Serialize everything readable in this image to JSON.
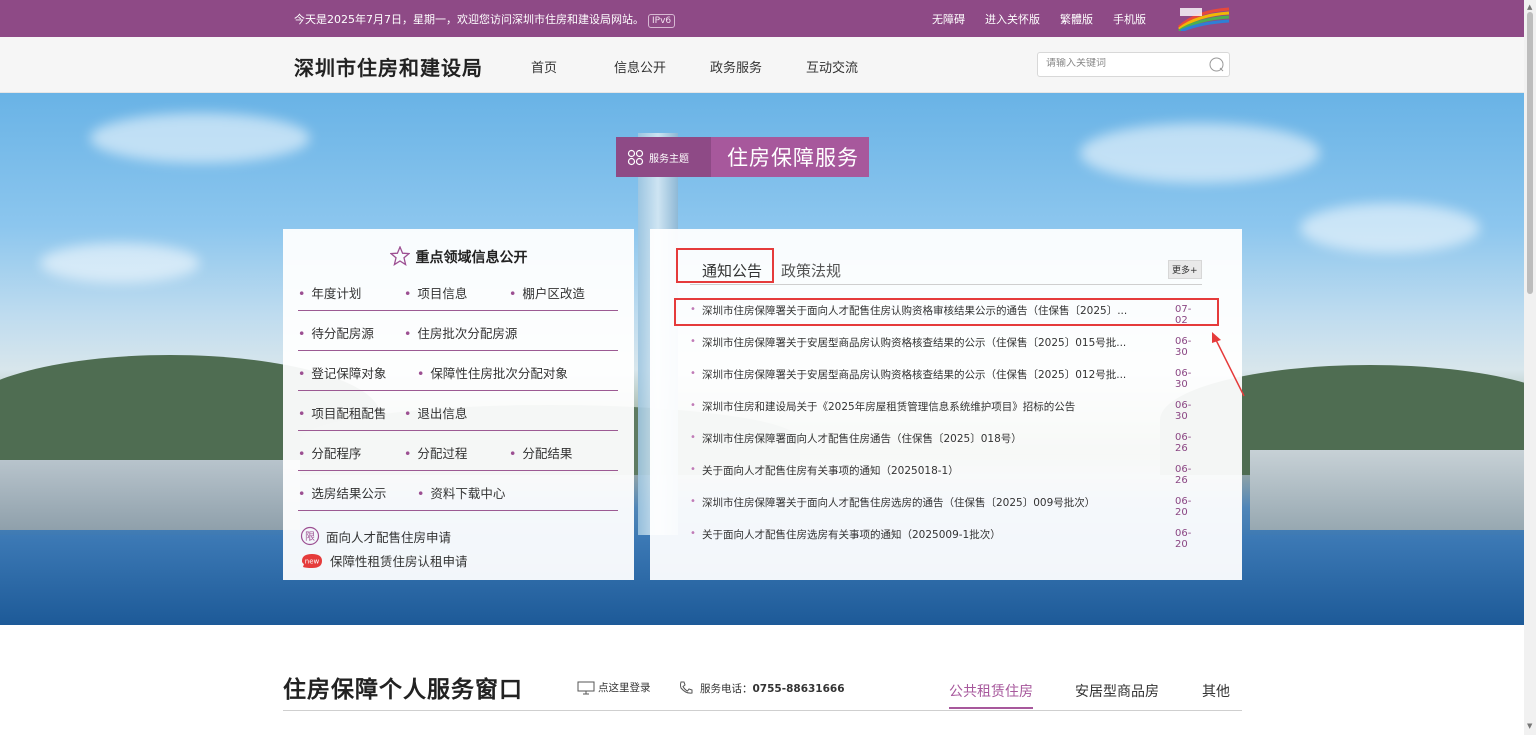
{
  "topbar": {
    "welcome": "今天是2025年7月7日，星期一，欢迎您访问深圳市住房和建设局网站。",
    "ipv6": "IPv6",
    "links": [
      "无障碍",
      "进入关怀版",
      "繁體版",
      "手机版"
    ]
  },
  "header": {
    "site_title": "深圳市住房和建设局",
    "nav": [
      "首页",
      "信息公开",
      "政务服务",
      "互动交流"
    ],
    "search_placeholder": "请输入关键词"
  },
  "theme": {
    "tag_label": "服务主题",
    "title": "住房保障服务"
  },
  "left_panel": {
    "title": "重点领域信息公开",
    "rows": [
      [
        "年度计划",
        "项目信息",
        "棚户区改造"
      ],
      [
        "待分配房源",
        "住房批次分配房源"
      ],
      [
        "登记保障对象",
        "保障性住房批次分配对象"
      ],
      [
        "项目配租配售",
        "退出信息"
      ],
      [
        "分配程序",
        "分配过程",
        "分配结果"
      ],
      [
        "选房结果公示",
        "资料下载中心"
      ]
    ],
    "apply_1": "面向人才配售住房申请",
    "apply_2": "保障性租赁住房认租申请",
    "new_badge": "new",
    "limit_badge": "限"
  },
  "right_panel": {
    "tabs": [
      "通知公告",
      "政策法规"
    ],
    "more": "更多+",
    "notices": [
      {
        "title": "深圳市住房保障署关于面向人才配售住房认购资格审核结果公示的通告（住保售〔2025〕...",
        "date": "07-02"
      },
      {
        "title": "深圳市住房保障署关于安居型商品房认购资格核查结果的公示（住保售〔2025〕015号批...",
        "date": "06-30"
      },
      {
        "title": "深圳市住房保障署关于安居型商品房认购资格核查结果的公示（住保售〔2025〕012号批...",
        "date": "06-30"
      },
      {
        "title": "深圳市住房和建设局关于《2025年房屋租赁管理信息系统维护项目》招标的公告",
        "date": "06-30"
      },
      {
        "title": "深圳市住房保障署面向人才配售住房通告（住保售〔2025〕018号）",
        "date": "06-26"
      },
      {
        "title": "关于面向人才配售住房有关事项的通知（2025018-1）",
        "date": "06-26"
      },
      {
        "title": "深圳市住房保障署关于面向人才配售住房选房的通告（住保售〔2025〕009号批次）",
        "date": "06-20"
      },
      {
        "title": "关于面向人才配售住房选房有关事项的通知（2025009-1批次）",
        "date": "06-20"
      }
    ]
  },
  "bottom": {
    "title": "住房保障个人服务窗口",
    "login": "点这里登录",
    "phone_label": "服务电话：",
    "phone": "0755-88631666",
    "tabs": [
      "公共租赁住房",
      "安居型商品房",
      "其他"
    ]
  },
  "colors": {
    "brand_purple": "#8e4a86",
    "accent_purple": "#a7589c",
    "annotation_red": "#e53b3b"
  }
}
